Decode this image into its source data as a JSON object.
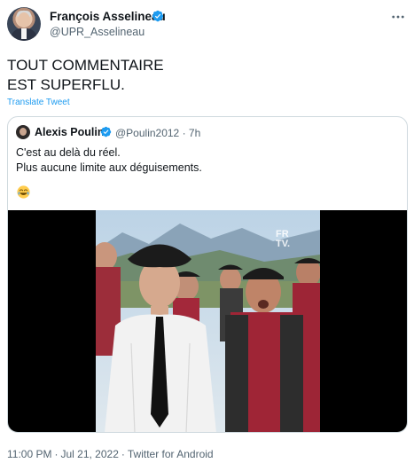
{
  "tweet": {
    "author_name": "François Asselineau",
    "author_handle": "@UPR_Asselineau",
    "text_lines": [
      "TOUT COMMENTAIRE",
      "EST SUPERFLU."
    ],
    "translate_label": "Translate Tweet",
    "time": "11:00 PM",
    "date": "Jul 21, 2022",
    "source": "Twitter for Android",
    "separator": "·"
  },
  "quote": {
    "author_name": "Alexis Poulin",
    "author_handle": "@Poulin2012 · 7h",
    "text_lines": [
      "C'est au delà du réel.",
      "Plus aucune limite aux déguisements."
    ],
    "emoji": "joy-emoji",
    "video_watermark": [
      "FR",
      "TV."
    ]
  },
  "colors": {
    "accent": "#1d9bf0",
    "secondary_text": "#536471",
    "border": "#cfd9de",
    "beret": "#1b1b1b",
    "shirt_red": "#a3283a"
  }
}
